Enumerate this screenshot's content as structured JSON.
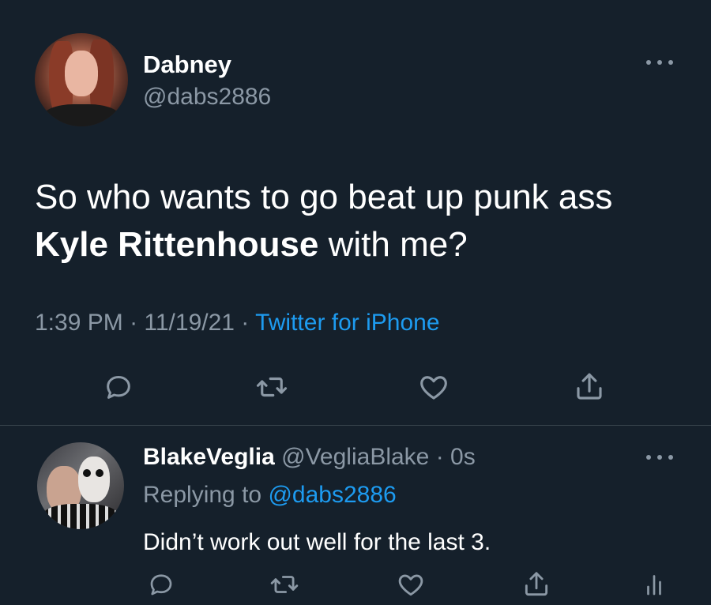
{
  "main_tweet": {
    "display_name": "Dabney",
    "handle": "@dabs2886",
    "text_part1": "So who wants to go beat up punk ass",
    "text_bold": "Kyle Rittenhouse",
    "text_part2": "with me?",
    "time": "1:39 PM",
    "sep1": " · ",
    "date": "11/19/21",
    "sep2": " · ",
    "source": "Twitter for iPhone"
  },
  "reply_tweet": {
    "display_name": "BlakeVeglia",
    "handle_time": "@VegliaBlake · 0s",
    "replying_prefix": "Replying to",
    "replying_mention": "@dabs2886",
    "text": "Didn’t work out well for the last 3."
  },
  "icons": {
    "reply": "speech-bubble-icon",
    "retweet": "retweet-icon",
    "like": "heart-icon",
    "share": "share-icon",
    "analytics": "analytics-icon",
    "more": "more-dots-icon"
  },
  "colors": {
    "background": "#15202b",
    "text_primary": "#ffffff",
    "text_secondary": "#8b98a5",
    "accent": "#1d9bf0",
    "divider": "#38444d"
  }
}
